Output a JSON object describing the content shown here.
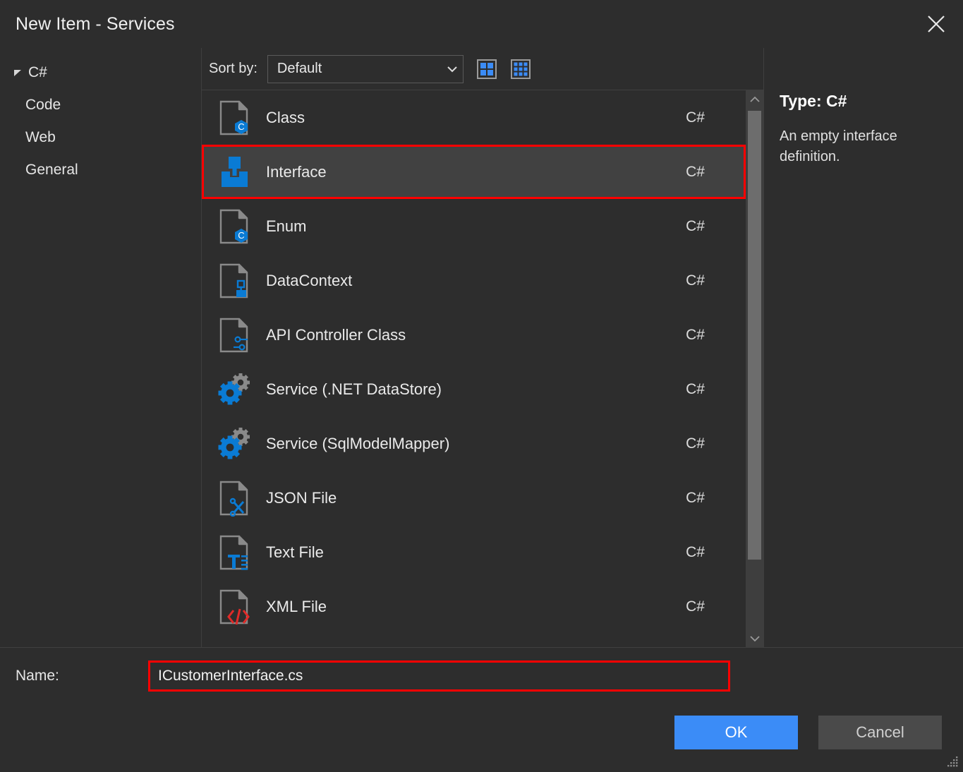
{
  "window": {
    "title": "New Item  -  Services",
    "close_icon": "close-icon"
  },
  "sidebar": {
    "items": [
      {
        "label": "C#",
        "level": 0,
        "expanded": true
      },
      {
        "label": "Code",
        "level": 1
      },
      {
        "label": "Web",
        "level": 1
      },
      {
        "label": "General",
        "level": 1
      }
    ]
  },
  "toolbar": {
    "sort_label": "Sort by:",
    "sort_value": "Default",
    "sort_options": [
      "Default"
    ],
    "large_icons_name": "large-icons-view-icon",
    "small_icons_name": "small-icons-view-icon"
  },
  "list": {
    "items": [
      {
        "label": "Class",
        "lang": "C#",
        "icon": "csharp-file-icon",
        "selected": false
      },
      {
        "label": "Interface",
        "lang": "C#",
        "icon": "interface-icon",
        "selected": true
      },
      {
        "label": "Enum",
        "lang": "C#",
        "icon": "csharp-file-icon",
        "selected": false
      },
      {
        "label": "DataContext",
        "lang": "C#",
        "icon": "datacontext-icon",
        "selected": false
      },
      {
        "label": "API Controller Class",
        "lang": "C#",
        "icon": "api-controller-icon",
        "selected": false
      },
      {
        "label": "Service (.NET DataStore)",
        "lang": "C#",
        "icon": "gears-icon",
        "selected": false
      },
      {
        "label": "Service (SqlModelMapper)",
        "lang": "C#",
        "icon": "gears-icon",
        "selected": false
      },
      {
        "label": "JSON File",
        "lang": "C#",
        "icon": "json-file-icon",
        "selected": false
      },
      {
        "label": "Text File",
        "lang": "C#",
        "icon": "text-file-icon",
        "selected": false
      },
      {
        "label": "XML File",
        "lang": "C#",
        "icon": "xml-file-icon",
        "selected": false
      }
    ]
  },
  "details": {
    "type": "Type: C#",
    "description": "An empty interface definition."
  },
  "footer": {
    "name_label": "Name:",
    "name_value": "ICustomerInterface.cs",
    "name_placeholder": "",
    "ok_label": "OK",
    "cancel_label": "Cancel"
  },
  "colors": {
    "dialog_bg": "#2d2d2d",
    "selected_row": "#414141",
    "highlight_border": "#ff0000",
    "accent_blue": "#3b8cf7",
    "icon_blue": "#0a7bd4",
    "icon_gray": "#8a8a8a",
    "xml_red": "#e02a28"
  }
}
